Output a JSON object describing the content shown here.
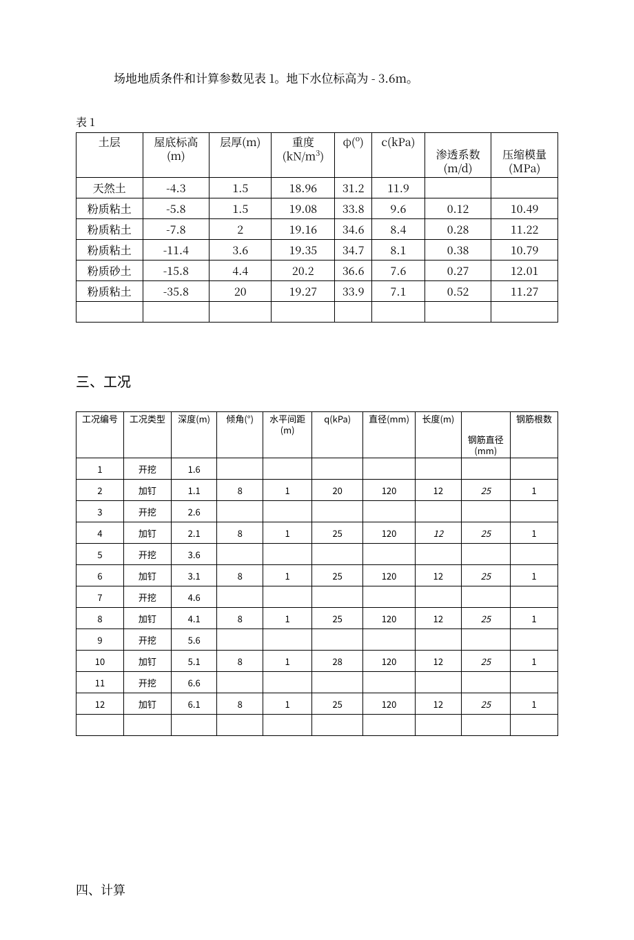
{
  "intro": "场地地质条件和计算参数见表 1。地下水位标高为 - 3.6m。",
  "table1": {
    "caption": "表 1",
    "headers": [
      "土层",
      "屋底标高(m)",
      "层厚(m)",
      "重度(kN/m³)",
      "φ(º)",
      "c(kPa)",
      "渗透系数(m/d)",
      "压缩模量(MPa)"
    ],
    "rows": [
      [
        "天然土",
        "-4.3",
        "1.5",
        "18.96",
        "31.2",
        "11.9",
        "",
        ""
      ],
      [
        "粉质粘土",
        "-5.8",
        "1.5",
        "19.08",
        "33.8",
        "9.6",
        "0.12",
        "10.49"
      ],
      [
        "粉质粘土",
        "-7.8",
        "2",
        "19.16",
        "34.6",
        "8.4",
        "0.28",
        "11.22"
      ],
      [
        "粉质粘土",
        "-11.4",
        "3.6",
        "19.35",
        "34.7",
        "8.1",
        "0.38",
        "10.79"
      ],
      [
        "粉质砂土",
        "-15.8",
        "4.4",
        "20.2",
        "36.6",
        "7.6",
        "0.27",
        "12.01"
      ],
      [
        "粉质粘土",
        "-35.8",
        "20",
        "19.27",
        "33.9",
        "7.1",
        "0.52",
        "11.27"
      ]
    ]
  },
  "section3": "三、工况",
  "table2": {
    "headers": [
      "工况编号",
      "工况类型",
      "深度(m)",
      "倾角(°)",
      "水平间距(m)",
      "q(kPa)",
      "直径(mm)",
      "长度(m)",
      "钢筋直径(mm)",
      "钢筋根数"
    ],
    "rows": [
      {
        "c": [
          "1",
          "开挖",
          "1.6",
          "",
          "",
          "",
          "",
          "",
          "",
          ""
        ]
      },
      {
        "c": [
          "2",
          "加钉",
          "1.1",
          "8",
          "1",
          "20",
          "120",
          "12",
          "25",
          "1"
        ]
      },
      {
        "c": [
          "3",
          "开挖",
          "2.6",
          "",
          "",
          "",
          "",
          "",
          "",
          ""
        ]
      },
      {
        "c": [
          "4",
          "加钉",
          "2.1",
          "8",
          "1",
          "25",
          "120",
          "12",
          "25",
          "1"
        ]
      },
      {
        "c": [
          "5",
          "开挖",
          "3.6",
          "",
          "",
          "",
          "",
          "",
          "",
          ""
        ]
      },
      {
        "c": [
          "6",
          "加钉",
          "3.1",
          "8",
          "1",
          "25",
          "120",
          "12",
          "25",
          "1"
        ]
      },
      {
        "c": [
          "7",
          "开挖",
          "4.6",
          "",
          "",
          "",
          "",
          "",
          "",
          ""
        ]
      },
      {
        "c": [
          "8",
          "加钉",
          "4.1",
          "8",
          "1",
          "25",
          "120",
          "12",
          "25",
          "1"
        ]
      },
      {
        "c": [
          "9",
          "开挖",
          "5.6",
          "",
          "",
          "",
          "",
          "",
          "",
          ""
        ]
      },
      {
        "c": [
          "10",
          "加钉",
          "5.1",
          "8",
          "1",
          "28",
          "120",
          "12",
          "25",
          "1"
        ]
      },
      {
        "c": [
          "11",
          "开挖",
          "6.6",
          "",
          "",
          "",
          "",
          "",
          "",
          ""
        ]
      },
      {
        "c": [
          "12",
          "加钉",
          "6.1",
          "8",
          "1",
          "25",
          "120",
          "12",
          "25",
          "1"
        ]
      }
    ]
  },
  "section4": "四、计算"
}
